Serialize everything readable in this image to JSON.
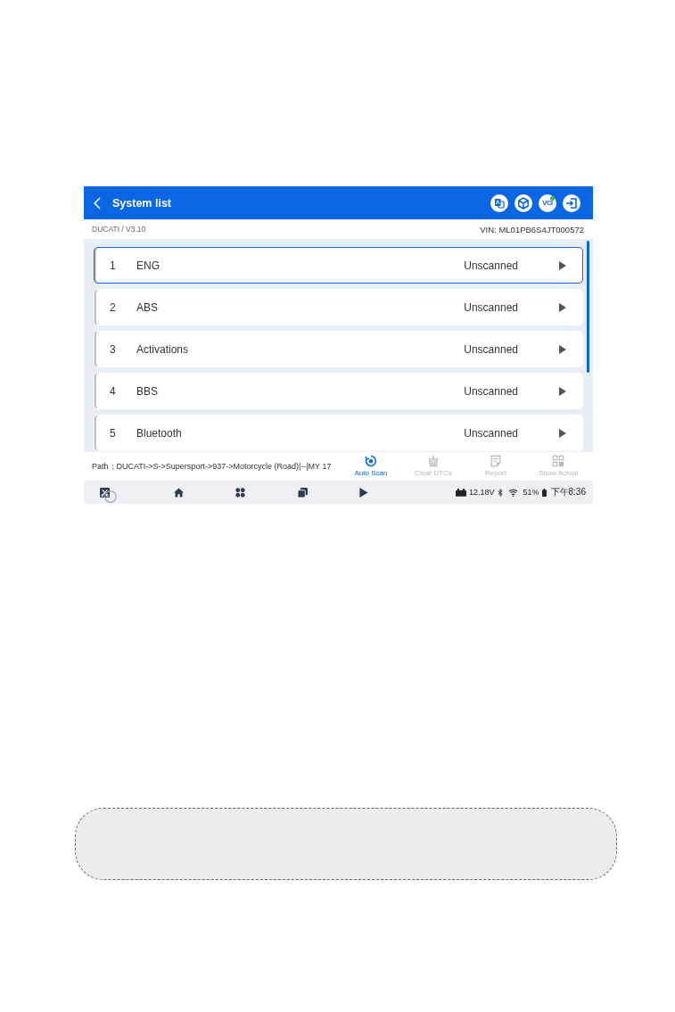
{
  "header": {
    "title": "System list",
    "vci_label": "VCI",
    "vci_connected": true
  },
  "info": {
    "make_version": "DUCATI / V3.10",
    "vin": "VIN: ML01PB6S4JT000572"
  },
  "systems": [
    {
      "number": "1",
      "name": "ENG",
      "status": "Unscanned",
      "selected": true
    },
    {
      "number": "2",
      "name": "ABS",
      "status": "Unscanned",
      "selected": false
    },
    {
      "number": "3",
      "name": "Activations",
      "status": "Unscanned",
      "selected": false
    },
    {
      "number": "4",
      "name": "BBS",
      "status": "Unscanned",
      "selected": false
    },
    {
      "number": "5",
      "name": "Bluetooth",
      "status": "Unscanned",
      "selected": false
    }
  ],
  "path": "Path：DUCATI->S->Supersport->937->Motorcycle (Road)|--|MY 17",
  "toolbar": [
    {
      "kind": "auto_scan",
      "label": "Auto Scan",
      "disabled": false
    },
    {
      "kind": "clear_dtcs",
      "label": "Clear DTCs",
      "disabled": true
    },
    {
      "kind": "report",
      "label": "Report",
      "disabled": true
    },
    {
      "kind": "show_actual",
      "label": "Show Actual",
      "disabled": true
    }
  ],
  "status_bar": {
    "voltage": "12.18V",
    "battery": "51%",
    "time": "下午8:36"
  }
}
